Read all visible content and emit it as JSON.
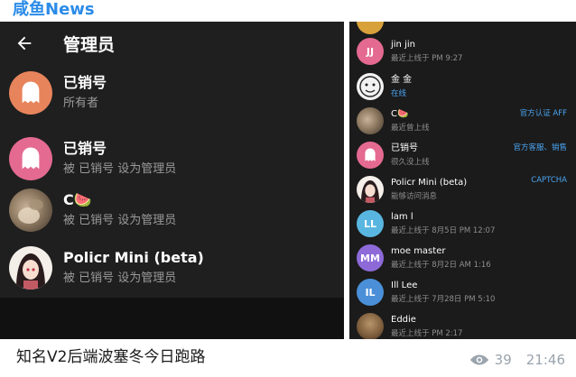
{
  "channel": {
    "title": "咸鱼News"
  },
  "left_screen": {
    "back_icon": "arrow-left-icon",
    "title": "管理员",
    "admins": [
      {
        "name": "已销号",
        "subtitle": "所有者",
        "avatar": "ghost",
        "avatar_color": "#e8845c"
      },
      {
        "name": "已销号",
        "subtitle": "被 已销号 设为管理员",
        "avatar": "ghost",
        "avatar_color": "#e46a92"
      },
      {
        "name": "C🍉",
        "subtitle": "被 已销号 设为管理员",
        "avatar": "photo"
      },
      {
        "name": "Policr Mini (beta)",
        "subtitle": "被 已销号 设为管理员",
        "avatar": "anime"
      }
    ]
  },
  "right_screen": {
    "members": [
      {
        "name": "",
        "status": "",
        "tag": "",
        "avatar": "partial",
        "avatar_color": "#d9a13a"
      },
      {
        "name": "jin jin",
        "status": "最近上线于 PM 9:27",
        "tag": "",
        "avatar": "initials",
        "initials": "JJ",
        "avatar_color": "#e46a92"
      },
      {
        "name": "金 金",
        "status": "在线",
        "online": true,
        "tag": "",
        "avatar": "drawing"
      },
      {
        "name": "C🍉",
        "status": "最近曾上线",
        "tag": "官方认证 AFF",
        "avatar": "photo"
      },
      {
        "name": "已销号",
        "status": "很久没上线",
        "tag": "官方客服、销售",
        "avatar": "ghost",
        "avatar_color": "#e46a92"
      },
      {
        "name": "Policr Mini (beta)",
        "status": "能够访问消息",
        "tag": "CAPTCHA",
        "avatar": "anime"
      },
      {
        "name": "lam l",
        "status": "最近上线于 8月5日 PM 12:07",
        "tag": "",
        "avatar": "initials",
        "initials": "LL",
        "avatar_color": "#59b6e0"
      },
      {
        "name": "moe master",
        "status": "最近上线于 8月2日 AM 1:16",
        "tag": "",
        "avatar": "initials",
        "initials": "MM",
        "avatar_color": "#8d6ad8"
      },
      {
        "name": "Ill Lee",
        "status": "最近上线于 7月28日 PM 5:10",
        "tag": "",
        "avatar": "initials",
        "initials": "IL",
        "avatar_color": "#4a8fd8"
      },
      {
        "name": "Eddie",
        "status": "最近上线于 PM 2:17",
        "tag": "",
        "avatar": "photo2"
      }
    ]
  },
  "post": {
    "caption": "知名V2后端波塞冬今日跑路",
    "views": "39",
    "time": "21:46",
    "view_icon": "eye-icon"
  }
}
